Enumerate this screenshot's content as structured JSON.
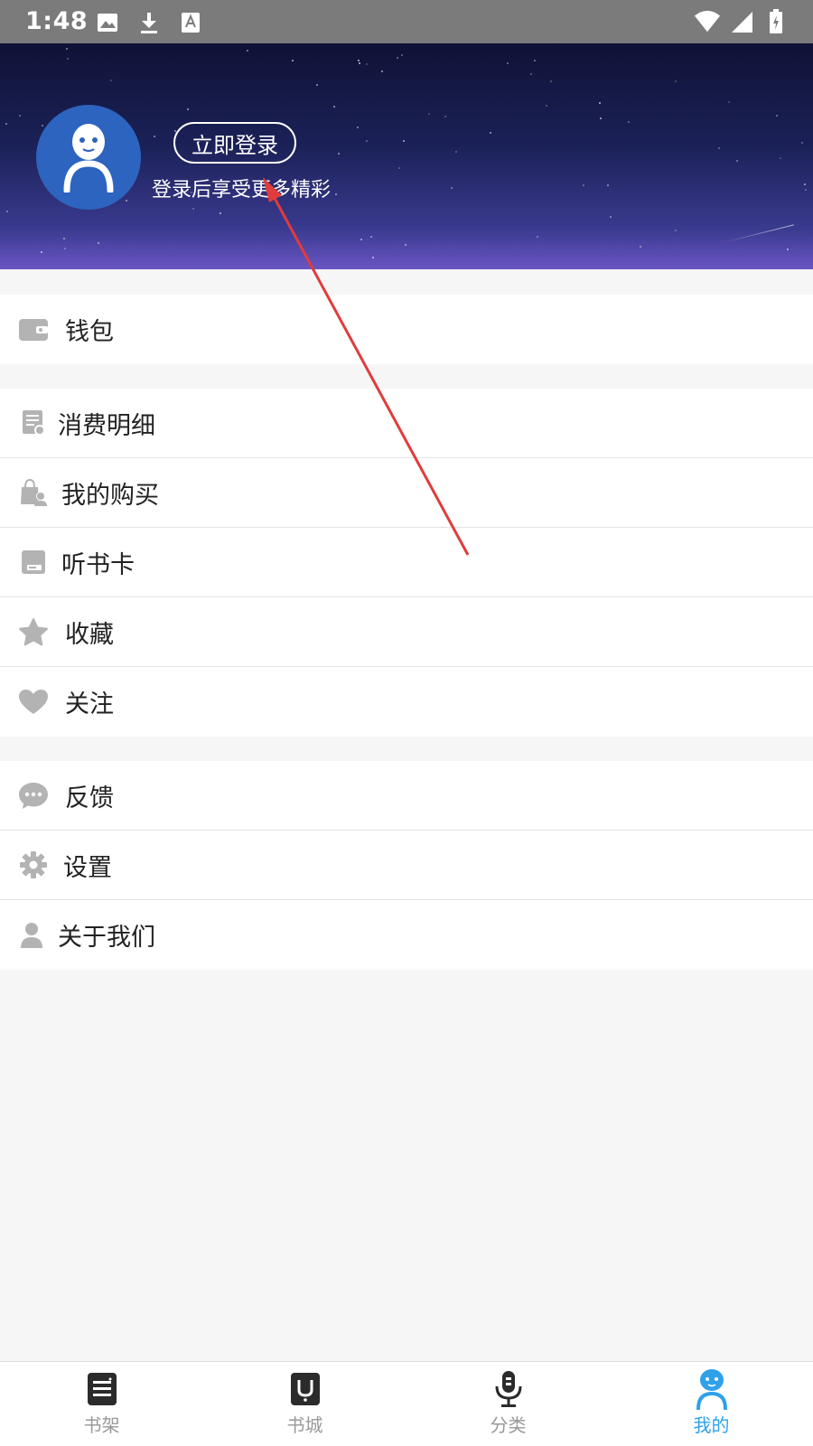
{
  "status_bar": {
    "time": "1:48"
  },
  "header": {
    "login_button": "立即登录",
    "subtitle": "登录后享受更多精彩"
  },
  "sections": [
    {
      "items": [
        {
          "label": "钱包",
          "icon": "wallet-icon"
        }
      ]
    },
    {
      "items": [
        {
          "label": "消费明细",
          "icon": "receipt-icon"
        },
        {
          "label": "我的购买",
          "icon": "shopping-bag-icon"
        },
        {
          "label": "听书卡",
          "icon": "card-icon"
        },
        {
          "label": "收藏",
          "icon": "star-icon"
        },
        {
          "label": "关注",
          "icon": "heart-icon"
        }
      ]
    },
    {
      "items": [
        {
          "label": "反馈",
          "icon": "chat-bubble-icon"
        },
        {
          "label": "设置",
          "icon": "gear-icon"
        },
        {
          "label": "关于我们",
          "icon": "person-icon"
        }
      ]
    }
  ],
  "bottom_nav": [
    {
      "label": "书架",
      "icon": "bookshelf-icon",
      "active": false
    },
    {
      "label": "书城",
      "icon": "bookstore-icon",
      "active": false
    },
    {
      "label": "分类",
      "icon": "microphone-icon",
      "active": false
    },
    {
      "label": "我的",
      "icon": "profile-icon",
      "active": true
    }
  ],
  "colors": {
    "accent": "#2ea1e8",
    "avatar_bg": "#2d64bf",
    "icon_gray": "#b3b3b3",
    "annotation_arrow": "#e03c3c"
  }
}
